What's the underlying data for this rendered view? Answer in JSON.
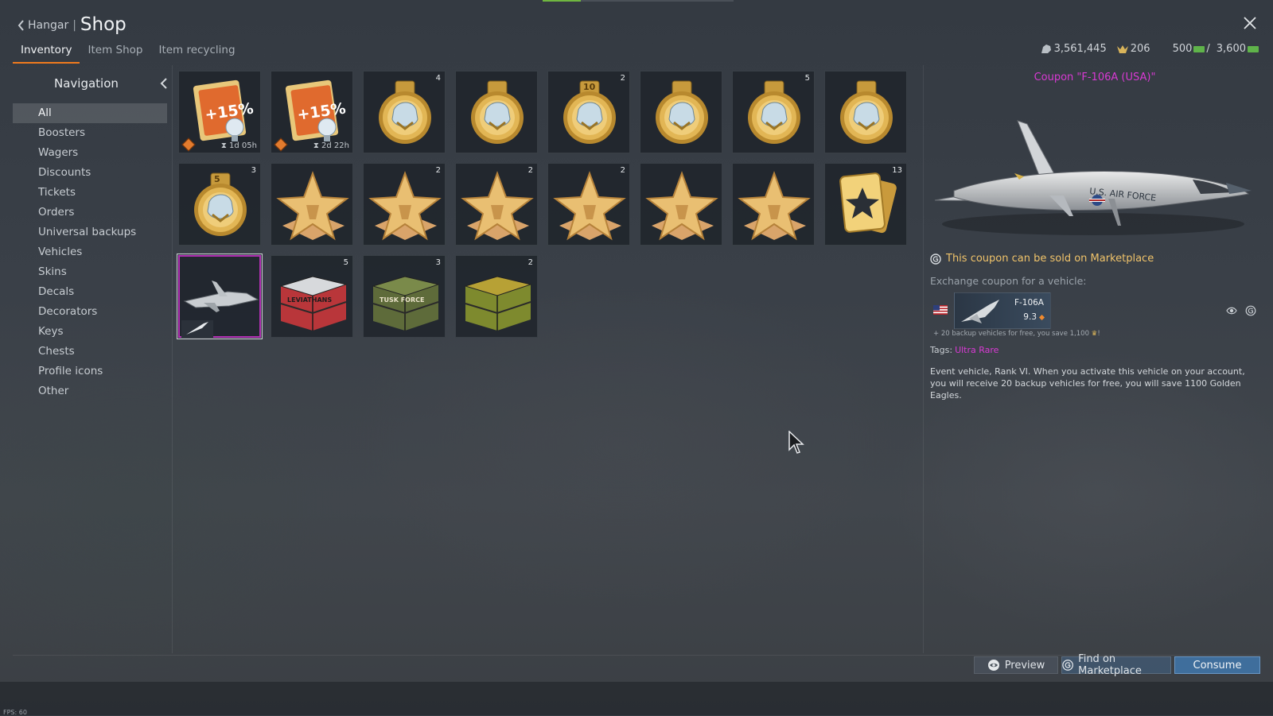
{
  "header": {
    "back_label": "Hangar",
    "title": "Shop"
  },
  "tabs": [
    {
      "label": "Inventory"
    },
    {
      "label": "Item Shop"
    },
    {
      "label": "Item recycling"
    }
  ],
  "wallet": {
    "silver_lions": "3,561,445",
    "golden_eagles": "206",
    "cash_a": "500",
    "cash_b": "3,600"
  },
  "sidebar": {
    "title": "Navigation",
    "items": [
      {
        "label": "All"
      },
      {
        "label": "Boosters"
      },
      {
        "label": "Wagers"
      },
      {
        "label": "Discounts"
      },
      {
        "label": "Tickets"
      },
      {
        "label": "Orders"
      },
      {
        "label": "Universal backups"
      },
      {
        "label": "Vehicles"
      },
      {
        "label": "Skins"
      },
      {
        "label": "Decals"
      },
      {
        "label": "Decorators"
      },
      {
        "label": "Keys"
      },
      {
        "label": "Chests"
      },
      {
        "label": "Profile icons"
      },
      {
        "label": "Other"
      }
    ]
  },
  "inventory": {
    "items": [
      {
        "icon": "booster-15-icon",
        "badge": "+15%",
        "timer": "1d 05h"
      },
      {
        "icon": "booster-15-icon",
        "badge": "+15%",
        "timer": "2d 22h"
      },
      {
        "icon": "wager-medal-icon",
        "count": "4"
      },
      {
        "icon": "wager-medal-icon"
      },
      {
        "icon": "wager-medal-icon",
        "count": "2",
        "badge": "10"
      },
      {
        "icon": "wager-medal-icon"
      },
      {
        "icon": "wager-medal-icon",
        "count": "5"
      },
      {
        "icon": "wager-medal-icon"
      },
      {
        "icon": "wager-medal-icon",
        "count": "3",
        "badge": "5"
      },
      {
        "icon": "order-star-icon"
      },
      {
        "icon": "order-star-icon",
        "count": "2"
      },
      {
        "icon": "order-star-icon",
        "count": "2"
      },
      {
        "icon": "order-star-icon",
        "count": "2"
      },
      {
        "icon": "order-star-icon"
      },
      {
        "icon": "order-star-icon"
      },
      {
        "icon": "star-cards-icon",
        "count": "13"
      },
      {
        "icon": "vehicle-coupon-icon"
      },
      {
        "icon": "chest-leviathans-icon",
        "count": "5",
        "label": "LEVIATHANS"
      },
      {
        "icon": "chest-tusk-force-icon",
        "count": "3",
        "label": "TUSK FORCE"
      },
      {
        "icon": "chest-camo-icon",
        "count": "2"
      }
    ]
  },
  "details": {
    "title": "Coupon \"F-106A (USA)\"",
    "market_note": "This coupon can be sold on Marketplace",
    "exchange_label": "Exchange coupon for a vehicle:",
    "vehicle_name": "F-106A",
    "vehicle_br": "9.3",
    "backup_note": "+ 20 backup vehicles for free, you save 1,100",
    "tags_label": "Tags:",
    "tag": "Ultra Rare",
    "description": "Event vehicle, Rank VI. When you activate this vehicle on your account, you will receive 20 backup vehicles for free, you will save 1100 Golden Eagles.",
    "accent_color": "#d93ad4"
  },
  "actions": {
    "preview": "Preview",
    "find": "Find on Marketplace",
    "consume": "Consume"
  },
  "fps": "FPS: 60"
}
